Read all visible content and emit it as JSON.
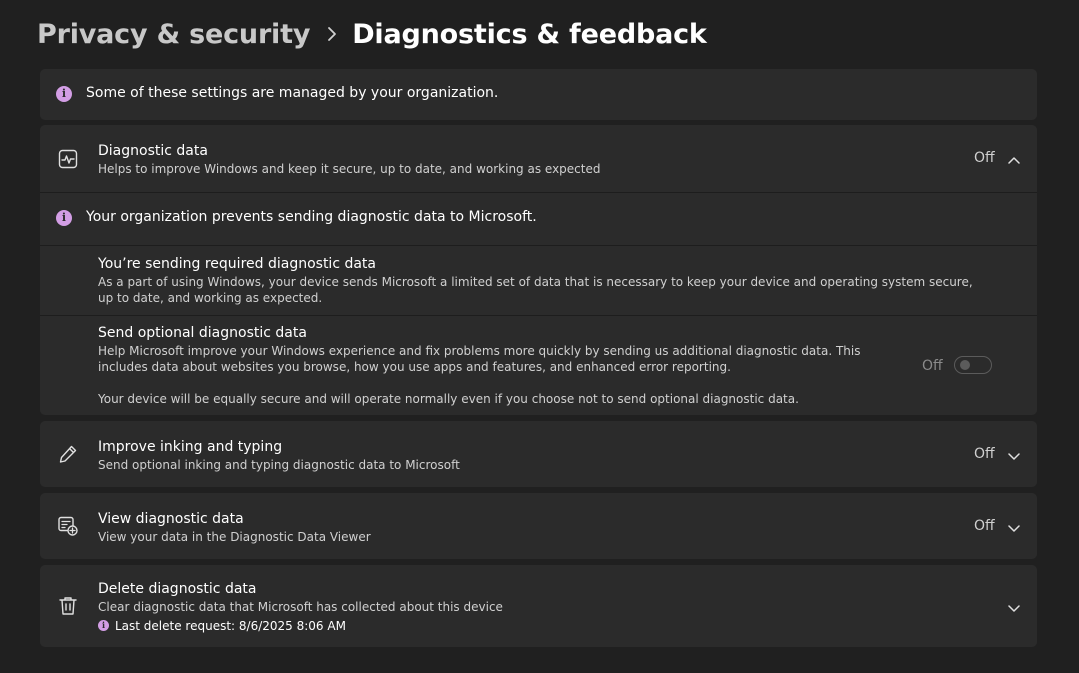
{
  "breadcrumb": {
    "parent": "Privacy & security",
    "current": "Diagnostics & feedback"
  },
  "org_banner": {
    "text": "Some of these settings are managed by your organization.",
    "icon": "info-icon"
  },
  "diagnostic_data": {
    "title": "Diagnostic data",
    "description": "Helps to improve Windows and keep it secure, up to date, and working as expected",
    "state": "Off",
    "icon": "heart-pulse-icon",
    "expanded": true,
    "org_notice": "Your organization prevents sending diagnostic data to Microsoft.",
    "required": {
      "title": "You’re sending required diagnostic data",
      "description": "As a part of using Windows, your device sends Microsoft a limited set of data that is necessary to keep your device and operating system secure, up to date, and working as expected."
    },
    "optional": {
      "title": "Send optional diagnostic data",
      "description": "Help Microsoft improve your Windows experience and fix problems more quickly by sending us additional diagnostic data. This includes data about websites you browse, how you use apps and features, and enhanced error reporting.",
      "note": "Your device will be equally secure and will operate normally even if you choose not to send optional diagnostic data.",
      "toggle_label": "Off",
      "toggle_on": false,
      "toggle_disabled": true
    }
  },
  "inking": {
    "title": "Improve inking and typing",
    "description": "Send optional inking and typing diagnostic data to Microsoft",
    "state": "Off",
    "icon": "pen-icon"
  },
  "view_data": {
    "title": "View diagnostic data",
    "description": "View your data in the Diagnostic Data Viewer",
    "state": "Off",
    "icon": "data-viewer-icon"
  },
  "delete_data": {
    "title": "Delete diagnostic data",
    "description": "Clear diagnostic data that Microsoft has collected about this device",
    "last_request": "Last delete request: 8/6/2025 8:06 AM",
    "icon": "trash-icon"
  },
  "colors": {
    "background": "#202020",
    "card": "#2b2b2b",
    "info_accent": "#d39ee5",
    "text_secondary": "#d0d0d0"
  }
}
